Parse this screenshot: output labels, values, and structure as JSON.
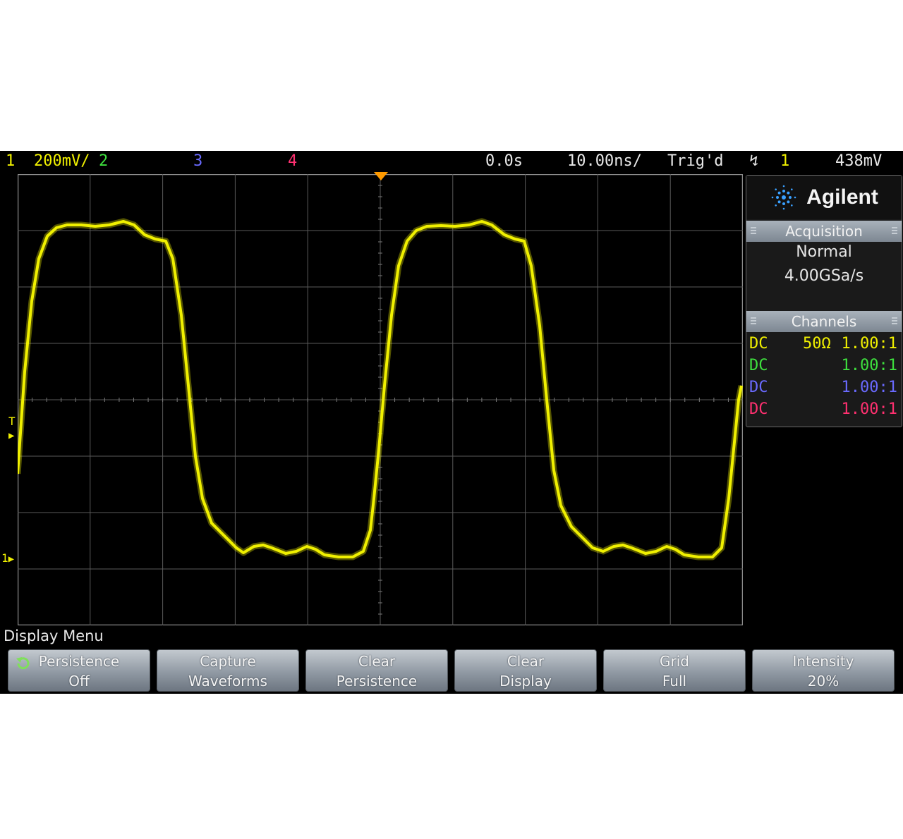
{
  "status_bar": {
    "ch1_label": "1",
    "ch1_scale": "200mV/",
    "ch2_label": "2",
    "ch3_label": "3",
    "ch4_label": "4",
    "time_offset": "0.0s",
    "time_scale": "10.00ns/",
    "trigger_state": "Trig'd",
    "trigger_source": "1",
    "trigger_level": "438mV"
  },
  "markers": {
    "trigger_level_marker": "T",
    "ground_marker": "1"
  },
  "side_panel": {
    "brand": "Agilent",
    "acquisition_header": "Acquisition",
    "acquisition_mode": "Normal",
    "sample_rate": "4.00GSa/s",
    "channels_header": "Channels",
    "channels": [
      {
        "coupling": "DC",
        "impedance": "50Ω",
        "probe": "1.00:1",
        "color": "#f0f000"
      },
      {
        "coupling": "DC",
        "impedance": "",
        "probe": "1.00:1",
        "color": "#3ee03e"
      },
      {
        "coupling": "DC",
        "impedance": "",
        "probe": "1.00:1",
        "color": "#6a6aff"
      },
      {
        "coupling": "DC",
        "impedance": "",
        "probe": "1.00:1",
        "color": "#ff3070"
      }
    ]
  },
  "menu": {
    "title": "Display Menu",
    "softkeys": [
      {
        "line1": "Persistence",
        "line2": "Off"
      },
      {
        "line1": "Capture",
        "line2": "Waveforms"
      },
      {
        "line1": "Clear",
        "line2": "Persistence"
      },
      {
        "line1": "Clear",
        "line2": "Display"
      },
      {
        "line1": "Grid",
        "line2": "Full"
      },
      {
        "line1": "Intensity",
        "line2": "20%"
      }
    ]
  },
  "colors": {
    "ch1": "#f0f000",
    "ch2": "#3ee03e",
    "ch3": "#6a6aff",
    "ch4": "#ff3070",
    "trigger_marker": "#ff9a00"
  }
}
